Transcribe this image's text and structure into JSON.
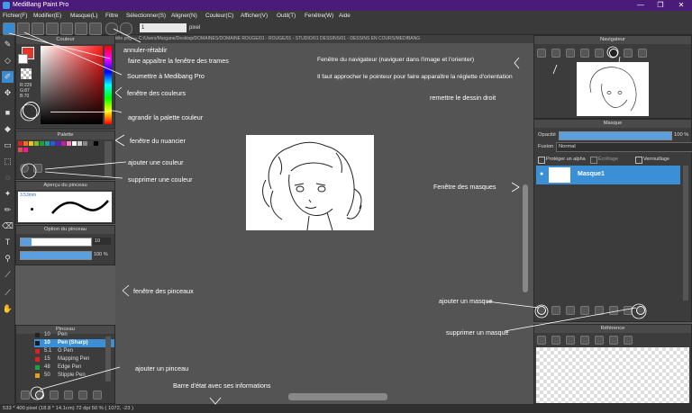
{
  "window": {
    "title": "MediBang Paint Pro",
    "minimize": "—",
    "restore": "❐",
    "close": "✕"
  },
  "menu": [
    "Fichier(F)",
    "Modifier(E)",
    "Masque(L)",
    "Filtre",
    "Sélectionner(S)",
    "Aligner(N)",
    "Couleur(C)",
    "Afficher(V)",
    "Outil(T)",
    "Fenêtre(W)",
    "Aide"
  ],
  "toolbar": {
    "brush_size": "1",
    "unit": "pixel"
  },
  "path": "tête.png — C:/Users/Margane/Desktop/DOMAINES/DOMAINE ROUGE/01 - ROUGE/01 - STUDIO/01 DESSINS/01 - DESSINS EN COURS/MEDIBANG",
  "colour_panel": {
    "title": "Couleur",
    "r": "R:229",
    "g": "G:87",
    "b": "B:70"
  },
  "palette_panel": {
    "title": "Palette"
  },
  "brush_preview_panel": {
    "title": "Aperçu du pinceau",
    "size": "3.53mm"
  },
  "brush_option_panel": {
    "title": "Option du pinceau",
    "size_value": "10",
    "opacity_value": "100 %"
  },
  "brush_panel": {
    "title": "Pinceau",
    "rows": [
      {
        "num": "10",
        "label": "Pen",
        "color": "#222222"
      },
      {
        "num": "10",
        "label": "Pen (Sharp)",
        "color": "#1a1a1a"
      },
      {
        "num": "5.1",
        "label": "G Pen",
        "color": "#e02020"
      },
      {
        "num": "15",
        "label": "Mapping Pen",
        "color": "#e02020"
      },
      {
        "num": "48",
        "label": "Edge Pen",
        "color": "#20a040"
      },
      {
        "num": "50",
        "label": "Stipple Pen",
        "color": "#e0a020"
      }
    ]
  },
  "navigator_panel": {
    "title": "Navigateur"
  },
  "layer_panel": {
    "title": "Masque",
    "opacity_label": "Opacité",
    "opacity_value": "100 %",
    "blend_label": "Fusion",
    "blend_value": "Normal",
    "protect_alpha": "Protéger un alpha",
    "clipping": "Écrêtage",
    "lock": "Verrouillage",
    "layer_name": "Masque1"
  },
  "reference_panel": {
    "title": "Référence"
  },
  "status": {
    "text": "533 * 400 pixel   (18.8 * 14.1cm)   72 dpi   50 %   ( 1072, -23 )"
  },
  "annotations": {
    "undo_redo": "annuler-rétablir",
    "show_frames": "faire appaître la fenêtre des trames",
    "submit": "Soumettre à Medibang Pro",
    "colour_window": "fenêtre des couleurs",
    "enlarge_palette": "agrandir la palette couleur",
    "palette_window": "fenêtre du nuancier",
    "add_colour": "ajouter une couleur",
    "delete_colour": "supprimer une couleur",
    "brush_window": "fenêtre des pinceaux",
    "add_brush": "ajouter un pinceau",
    "status_bar": "Barre d'état avec ses informations",
    "navigator_window": "Fenêtre du navigateur (naviguer dans l'image et l'orienter)",
    "rotation_hint": "Il faut approcher le pointeur pour faire apparaître la réglette d'orientation",
    "straighten": "remettre le dessin droit",
    "layer_window": "Fenêtre des masques",
    "add_layer": "ajouter un masque",
    "delete_layer": "supprimer un masque"
  }
}
